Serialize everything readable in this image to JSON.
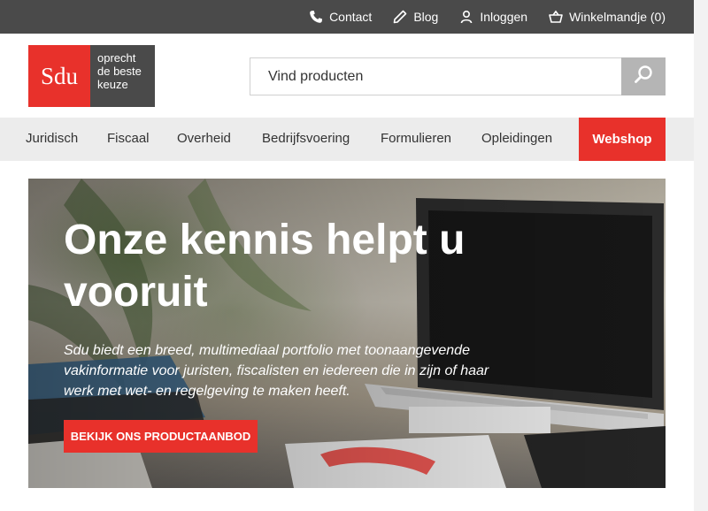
{
  "topbar": {
    "links": [
      {
        "label": "Contact",
        "icon": "phone-icon"
      },
      {
        "label": "Blog",
        "icon": "pencil-icon"
      },
      {
        "label": "Inloggen",
        "icon": "user-icon"
      },
      {
        "label": "Winkelmandje (0)",
        "icon": "basket-icon"
      }
    ]
  },
  "logo": {
    "mark": "Sdu",
    "tagline_1": "oprecht",
    "tagline_2": "de beste",
    "tagline_3": "keuze"
  },
  "search": {
    "placeholder": "Vind producten",
    "button_icon": "search-icon"
  },
  "nav": {
    "items": [
      "Juridisch",
      "Fiscaal",
      "Overheid",
      "Bedrijfsvoering",
      "Formulieren",
      "Opleidingen"
    ],
    "webshop": "Webshop"
  },
  "hero": {
    "title": "Onze kennis helpt u vooruit",
    "text": "Sdu biedt een breed, multimediaal portfolio met toonaangevende vakinformatie voor juristen, fiscalisten en iedereen die in zijn of haar werk met wet- en regelgeving te maken heeft.",
    "cta": "BEKIJK ONS PRODUCTAANBOD"
  },
  "colors": {
    "brand_red": "#e8312b",
    "topbar_bg": "#4a4a4a",
    "nav_bg": "#ececec"
  }
}
